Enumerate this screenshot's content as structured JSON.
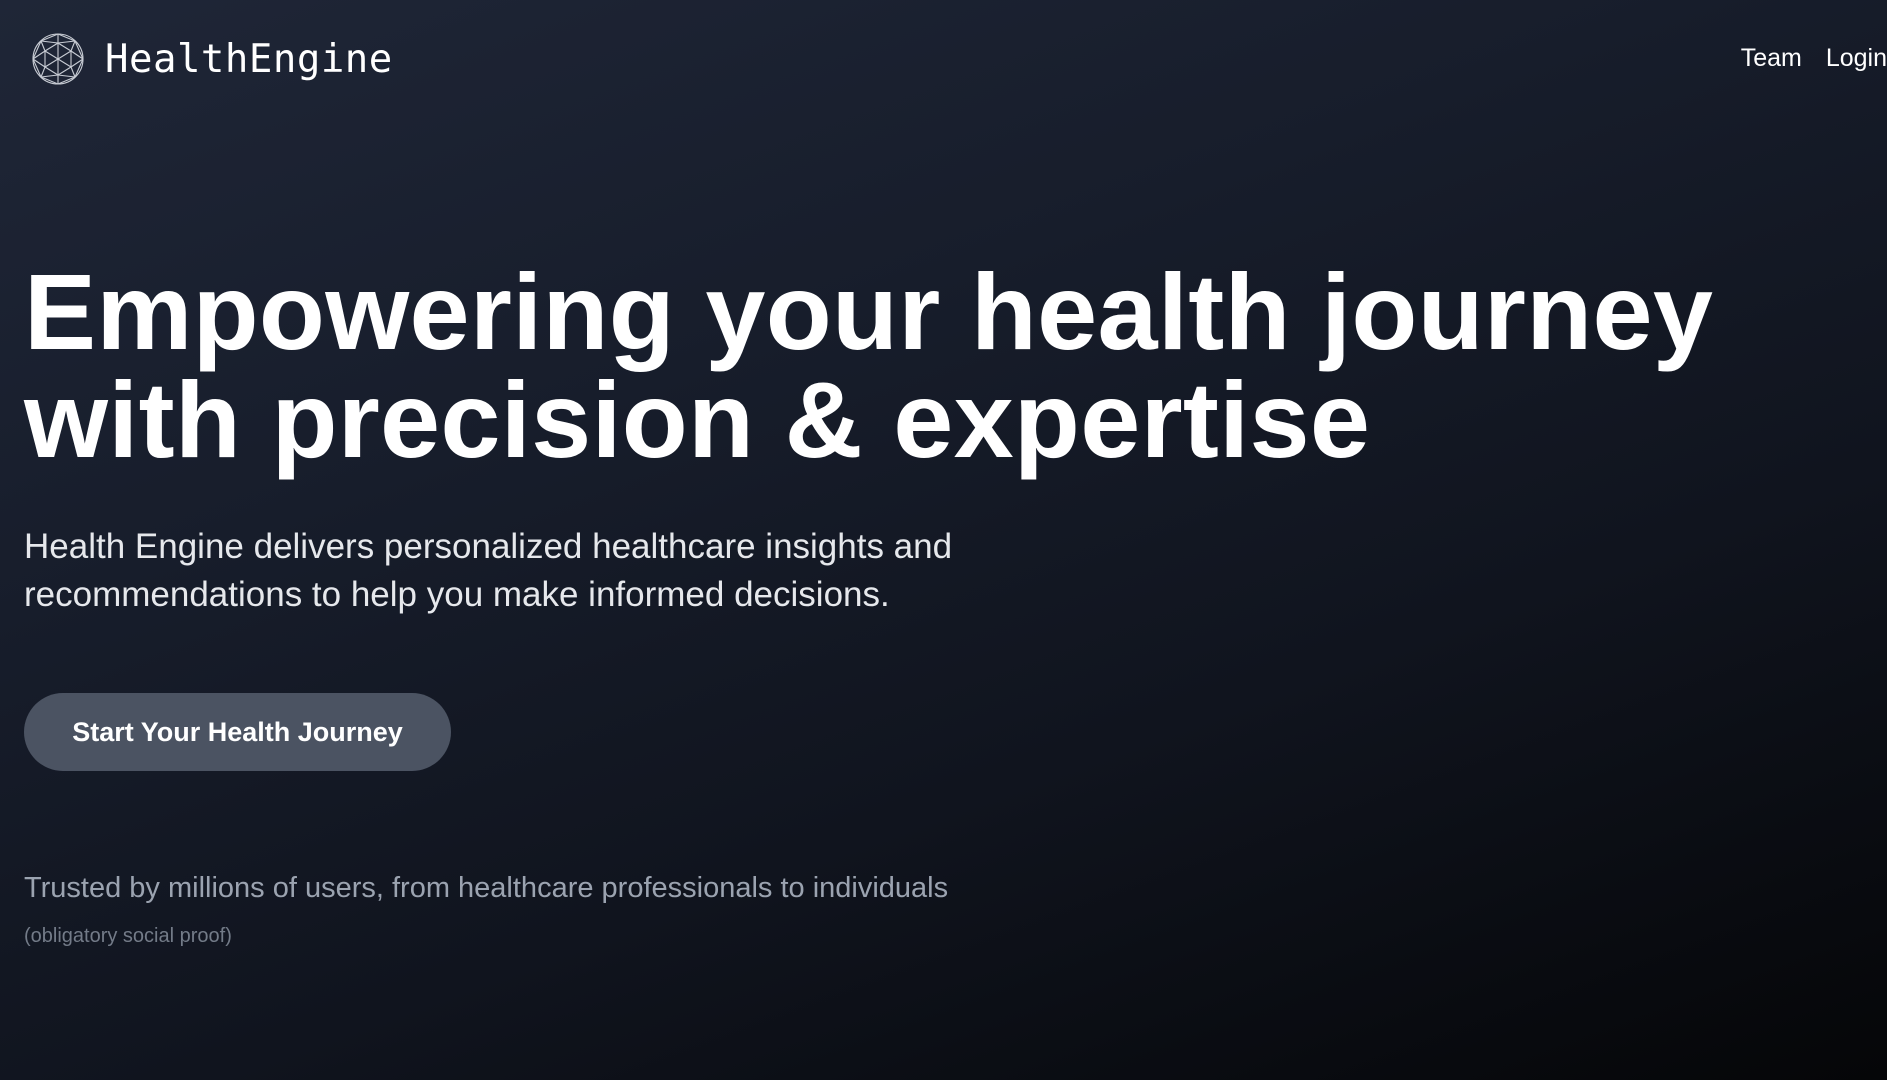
{
  "header": {
    "brand_name": "HealthEngine",
    "logo_icon": "geodesic-sphere-icon",
    "nav": [
      {
        "label": "Team"
      },
      {
        "label": "Login"
      }
    ]
  },
  "hero": {
    "title_line1": "Empowering your health journey",
    "title_line2": "with precision & expertise",
    "subtitle_line1": "Health Engine delivers personalized healthcare insights and",
    "subtitle_line2": "recommendations to help you make informed decisions.",
    "cta_label": "Start Your Health Journey"
  },
  "social_proof": {
    "text": "Trusted by millions of users, from healthcare professionals to individuals",
    "note": "(obligatory social proof)"
  },
  "colors": {
    "background_top": "#1f2637",
    "background_bottom": "#050608",
    "button_bg": "#4b5362",
    "text_primary": "#ffffff",
    "text_muted": "#9ba3b0"
  }
}
